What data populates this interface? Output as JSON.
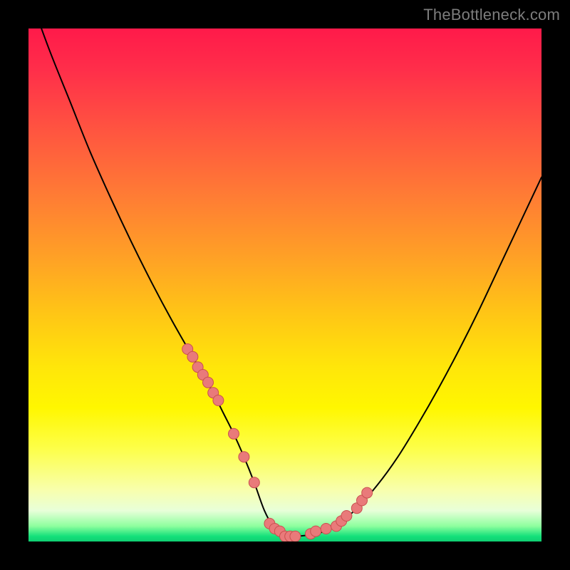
{
  "watermark": "TheBottleneck.com",
  "chart_data": {
    "type": "line",
    "title": "",
    "xlabel": "",
    "ylabel": "",
    "xlim": [
      0,
      100
    ],
    "ylim": [
      0,
      100
    ],
    "x": [
      0,
      4,
      8,
      12,
      16,
      20,
      24,
      28,
      32,
      34,
      36,
      38,
      40,
      42,
      44,
      46,
      48,
      50,
      52,
      56,
      60,
      64,
      68,
      72,
      76,
      80,
      84,
      88,
      92,
      96,
      100
    ],
    "values": [
      107,
      96,
      86,
      76,
      67,
      58.5,
      50.5,
      43,
      36,
      32.5,
      29,
      25,
      21,
      16.5,
      11.5,
      6,
      2.5,
      1,
      1,
      1.5,
      3,
      6.5,
      11,
      16.5,
      23,
      30,
      37.5,
      45.5,
      54,
      62.5,
      71
    ],
    "series": [
      {
        "name": "datapoints",
        "x": [
          31,
          32,
          33,
          34,
          35,
          36,
          37,
          40,
          42,
          44,
          47,
          48,
          49,
          50,
          51,
          52,
          55,
          56,
          58,
          60,
          61,
          62,
          64,
          65,
          66
        ],
        "y": [
          37.5,
          36,
          34,
          32.5,
          31,
          29,
          27.5,
          21,
          16.5,
          11.5,
          3.5,
          2.5,
          2,
          1,
          1,
          1,
          1.5,
          2,
          2.5,
          3,
          4,
          5,
          6.5,
          8,
          9.5
        ]
      }
    ],
    "colors": {
      "gradient_top": "#ff1a4a",
      "gradient_mid": "#ffe000",
      "gradient_bottom": "#13e07a",
      "curve": "#000000",
      "point_fill": "#e97a7a",
      "point_stroke": "#c95050"
    }
  }
}
